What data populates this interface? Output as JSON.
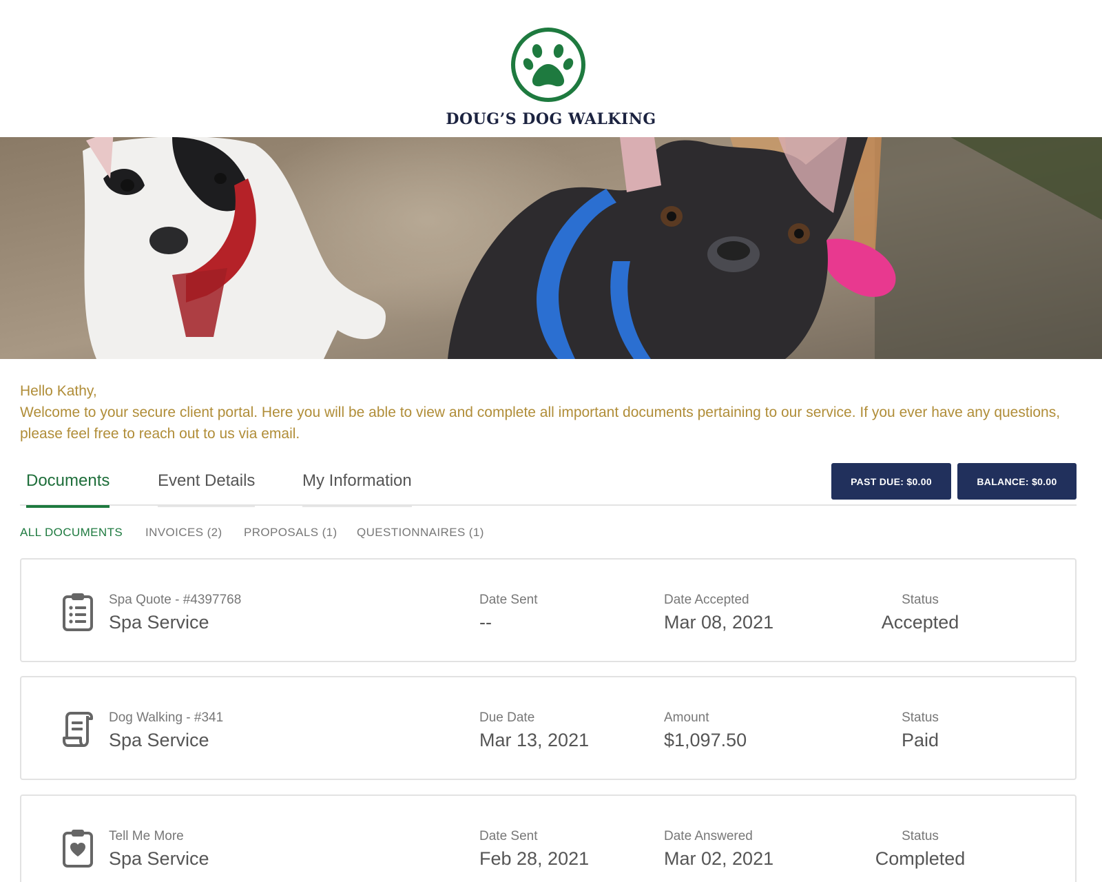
{
  "brand": {
    "name": "DOUG’S DOG WALKING",
    "accent_color": "#1e7a3f",
    "logo_icon": "paw-print-icon"
  },
  "greeting": {
    "salutation": "Hello Kathy,",
    "message": "Welcome to your secure client portal. Here you will be able to view and complete all important documents pertaining to our service. If you ever have any questions, please feel free to reach out to us via email."
  },
  "tabs": [
    {
      "label": "Documents",
      "active": true
    },
    {
      "label": "Event Details",
      "active": false
    },
    {
      "label": "My Information",
      "active": false
    }
  ],
  "account": {
    "past_due_label": "PAST DUE: $0.00",
    "balance_label": "BALANCE: $0.00"
  },
  "filters": [
    {
      "label": "ALL DOCUMENTS",
      "active": true
    },
    {
      "label": "INVOICES (2)",
      "active": false
    },
    {
      "label": "PROPOSALS (1)",
      "active": false
    },
    {
      "label": "QUESTIONNAIRES (1)",
      "active": false
    }
  ],
  "documents": [
    {
      "icon": "clipboard-list-icon",
      "name": "Spa Quote - #4397768",
      "service": "Spa Service",
      "col2_label": "Date Sent",
      "col2_value": "--",
      "col3_label": "Date Accepted",
      "col3_value": "Mar 08, 2021",
      "status_label": "Status",
      "status_value": "Accepted"
    },
    {
      "icon": "scroll-invoice-icon",
      "name": "Dog Walking - #341",
      "service": "Spa Service",
      "col2_label": "Due Date",
      "col2_value": "Mar 13, 2021",
      "col3_label": "Amount",
      "col3_value": "$1,097.50",
      "status_label": "Status",
      "status_value": "Paid"
    },
    {
      "icon": "clipboard-heart-icon",
      "name": "Tell Me More",
      "service": "Spa Service",
      "col2_label": "Date Sent",
      "col2_value": "Feb 28, 2021",
      "col3_label": "Date Answered",
      "col3_value": "Mar 02, 2021",
      "status_label": "Status",
      "status_value": "Completed"
    }
  ]
}
